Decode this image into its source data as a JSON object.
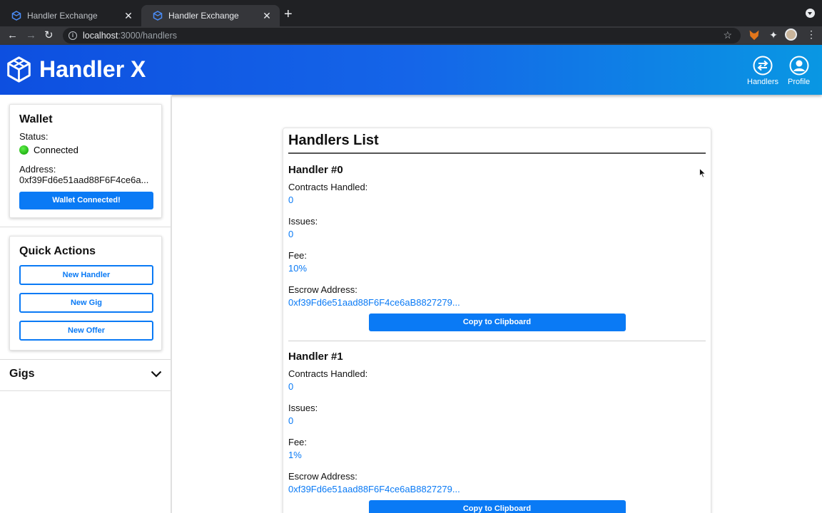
{
  "browser": {
    "tabs": [
      {
        "title": "Handler Exchange",
        "active": false
      },
      {
        "title": "Handler Exchange",
        "active": true
      }
    ],
    "url_host": "localhost",
    "url_rest": ":3000/handlers",
    "close_glyph": "✕",
    "newtab_glyph": "+"
  },
  "header": {
    "brand": "Handler X",
    "nav": [
      {
        "label": "Handlers",
        "icon": "swap-arrows-icon"
      },
      {
        "label": "Profile",
        "icon": "user-icon"
      }
    ]
  },
  "sidebar": {
    "wallet": {
      "title": "Wallet",
      "status_label": "Status:",
      "status_value": "Connected",
      "status_color": "#1fb80f",
      "address_label": "Address:",
      "address_value": "0xf39Fd6e51aad88F6F4ce6a...",
      "button_label": "Wallet Connected!"
    },
    "quick_actions": {
      "title": "Quick Actions",
      "buttons": [
        "New Handler",
        "New Gig",
        "New Offer"
      ]
    },
    "gigs": {
      "title": "Gigs"
    }
  },
  "main": {
    "title": "Handlers List",
    "handlers": [
      {
        "title": "Handler #0",
        "contracts_label": "Contracts Handled:",
        "contracts_value": "0",
        "issues_label": "Issues:",
        "issues_value": "0",
        "fee_label": "Fee:",
        "fee_value": "10%",
        "escrow_label": "Escrow Address:",
        "escrow_value": "0xf39Fd6e51aad88F6F4ce6aB8827279...",
        "copy_label": "Copy to Clipboard"
      },
      {
        "title": "Handler #1",
        "contracts_label": "Contracts Handled:",
        "contracts_value": "0",
        "issues_label": "Issues:",
        "issues_value": "0",
        "fee_label": "Fee:",
        "fee_value": "1%",
        "escrow_label": "Escrow Address:",
        "escrow_value": "0xf39Fd6e51aad88F6F4ce6aB8827279...",
        "copy_label": "Copy to Clipboard"
      }
    ]
  },
  "colors": {
    "accent": "#0a7af5",
    "header_start": "#0d4fe0",
    "header_end": "#0997e3"
  }
}
